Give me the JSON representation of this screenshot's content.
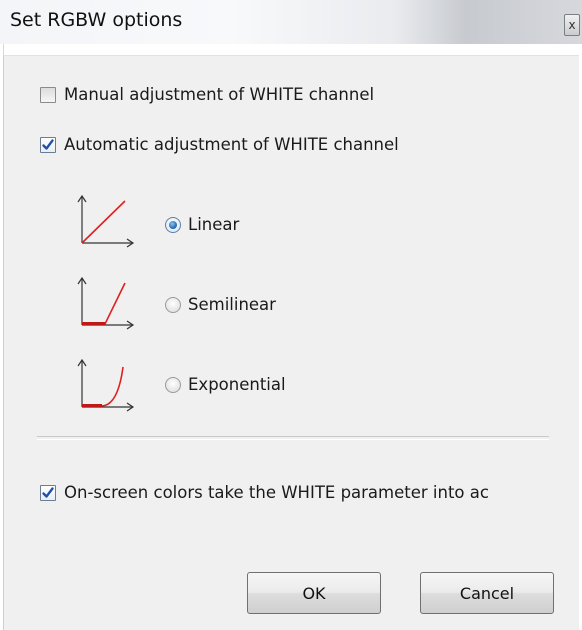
{
  "window": {
    "title": "Set RGBW options",
    "close_glyph": "x"
  },
  "options": {
    "manual": {
      "label": "Manual adjustment of WHITE channel",
      "checked": false
    },
    "automatic": {
      "label": "Automatic adjustment of WHITE channel",
      "checked": true
    },
    "on_screen": {
      "label": "On-screen colors take the WHITE parameter into ac",
      "checked": true
    }
  },
  "curves": [
    {
      "label": "Linear",
      "selected": true,
      "icon": "linear-curve-icon"
    },
    {
      "label": "Semilinear",
      "selected": false,
      "icon": "semilinear-curve-icon"
    },
    {
      "label": "Exponential",
      "selected": false,
      "icon": "exponential-curve-icon"
    }
  ],
  "buttons": {
    "ok": "OK",
    "cancel": "Cancel"
  },
  "colors": {
    "curve": "#e02020",
    "check": "#1f4fa8",
    "dialog_bg": "#f0f0f0"
  }
}
